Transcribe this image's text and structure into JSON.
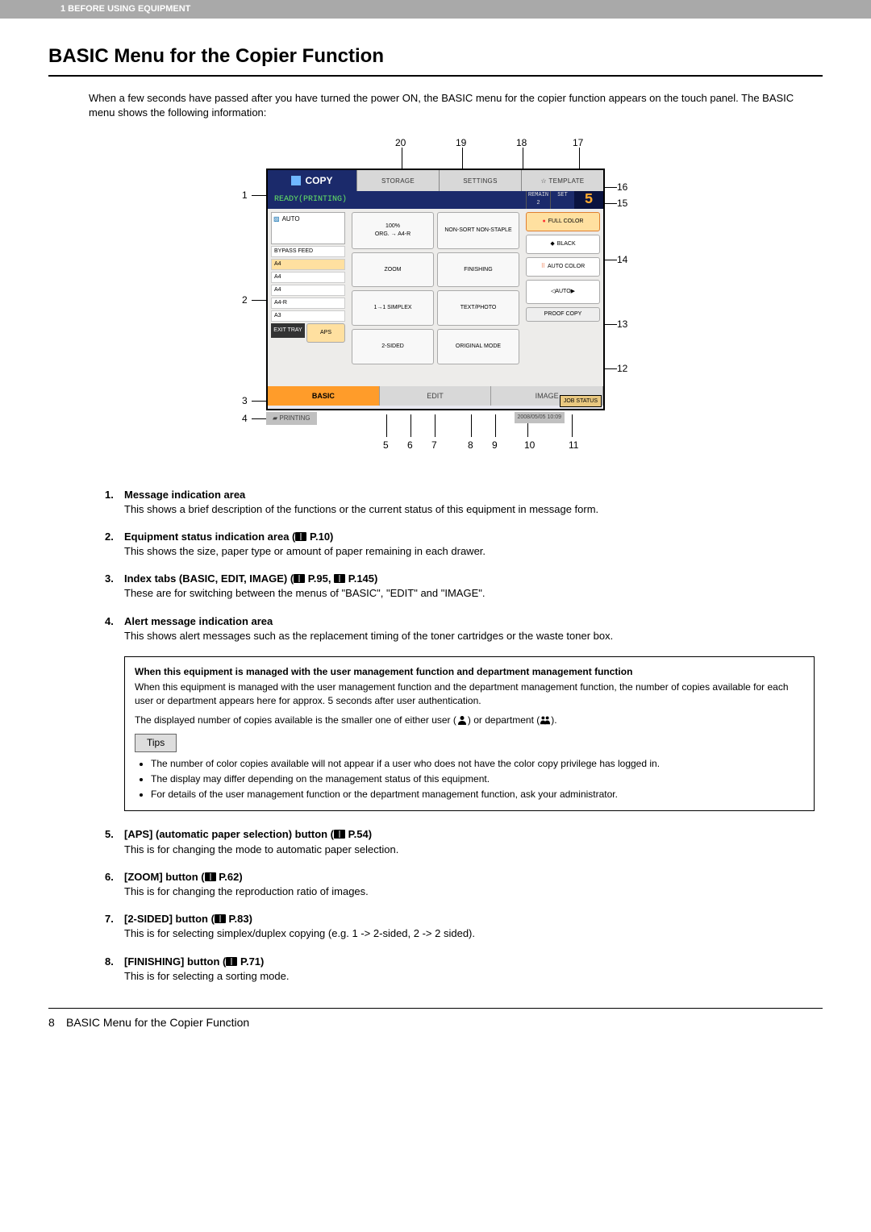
{
  "header": {
    "breadcrumb": "1 BEFORE USING EQUIPMENT"
  },
  "title": "BASIC Menu for the Copier Function",
  "intro": "When a few seconds have passed after you have turned the power ON, the BASIC menu for the copier function appears on the touch panel. The BASIC menu shows the following information:",
  "callouts": {
    "top": [
      "20",
      "19",
      "18",
      "17"
    ],
    "right": [
      "16",
      "15",
      "14",
      "13",
      "12"
    ],
    "left": [
      "1",
      "2",
      "3",
      "4"
    ],
    "bottom": [
      "5",
      "6",
      "7",
      "8",
      "9",
      "10",
      "11"
    ]
  },
  "screen": {
    "copy_tab": "COPY",
    "top_buttons": [
      "STORAGE",
      "SETTINGS",
      "☆ TEMPLATE"
    ],
    "status": "READY(PRINTING)",
    "counter_labels": [
      "REMAIN",
      "SET"
    ],
    "counter_small": "2",
    "counter_big": "5",
    "auto_label": "AUTO",
    "bypass": "BYPASS FEED",
    "paper_rows": [
      "A4",
      "A4",
      "A4",
      "A4-R",
      "A3"
    ],
    "exit_tray": "EXIT TRAY",
    "aps": "APS",
    "zoom_info": "100%",
    "zoom_detail": "ORG. → A4-R",
    "nonsort": "NON-SORT NON-STAPLE",
    "zoom_btn": "ZOOM",
    "finishing_btn": "FINISHING",
    "simplex": "1→1 SIMPLEX",
    "textphoto": "TEXT/PHOTO",
    "two_sided": "2-SIDED",
    "original_mode": "ORIGINAL MODE",
    "color_modes": [
      "FULL COLOR",
      "BLACK",
      "AUTO COLOR"
    ],
    "auto_slider": "AUTO",
    "proof": "PROOF COPY",
    "tabs": [
      "BASIC",
      "EDIT",
      "IMAGE"
    ],
    "alert": "PRINTING",
    "datetime": "2008/05/05 10:09",
    "job_status": "JOB STATUS"
  },
  "items": [
    {
      "num": "1.",
      "title": "Message indication area",
      "desc": "This shows a brief description of the functions or the current status of this equipment in message form."
    },
    {
      "num": "2.",
      "title_pre": "Equipment status indication area (",
      "title_ref": " P.10)",
      "desc": "This shows the size, paper type or amount of paper remaining in each drawer."
    },
    {
      "num": "3.",
      "title_pre": "Index tabs (BASIC, EDIT, IMAGE) (",
      "title_mid": " P.95, ",
      "title_ref": " P.145)",
      "desc": "These are for switching between the menus of \"BASIC\", \"EDIT\" and \"IMAGE\"."
    },
    {
      "num": "4.",
      "title": "Alert message indication area",
      "desc": "This shows alert messages such as the replacement timing of the toner cartridges or the waste toner box."
    }
  ],
  "note": {
    "heading": "When this equipment is managed with the user management function and department management function",
    "body": "When this equipment is managed with the user management function and the department management function, the number of copies available for each user or department appears here for approx. 5 seconds after user authentication.",
    "line2_pre": "The displayed number of copies available is the smaller one of either user (",
    "line2_mid": ") or department (",
    "line2_post": ").",
    "tips_label": "Tips",
    "tips": [
      "The number of color copies available will not appear if a user who does not have the color copy privilege has logged in.",
      "The display may differ depending on the management status of this equipment.",
      "For details of the user management function or the department management function, ask your administrator."
    ]
  },
  "items2": [
    {
      "num": "5.",
      "title_pre": "[APS] (automatic paper selection) button (",
      "title_ref": " P.54)",
      "desc": "This is for changing the mode to automatic paper selection."
    },
    {
      "num": "6.",
      "title_pre": "[ZOOM] button (",
      "title_ref": " P.62)",
      "desc": "This is for changing the reproduction ratio of images."
    },
    {
      "num": "7.",
      "title_pre": "[2-SIDED] button (",
      "title_ref": " P.83)",
      "desc": "This is for selecting simplex/duplex copying (e.g. 1 -> 2-sided, 2 -> 2 sided)."
    },
    {
      "num": "8.",
      "title_pre": "[FINISHING] button (",
      "title_ref": " P.71)",
      "desc": "This is for selecting a sorting mode."
    }
  ],
  "footer": {
    "page": "8",
    "title": "BASIC Menu for the Copier Function"
  }
}
